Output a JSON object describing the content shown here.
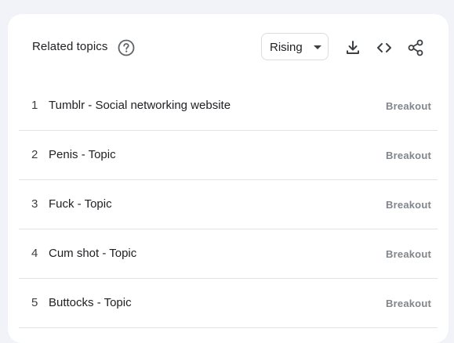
{
  "header": {
    "title": "Related topics",
    "help_icon": "help-circle-icon",
    "filter": {
      "selected": "Rising",
      "icon": "dropdown-caret-icon"
    },
    "tools": [
      "download-icon",
      "embed-code-icon",
      "share-icon"
    ]
  },
  "topics": [
    {
      "rank": "1",
      "label": "Tumblr - Social networking website",
      "value": "Breakout"
    },
    {
      "rank": "2",
      "label": "Penis - Topic",
      "value": "Breakout"
    },
    {
      "rank": "3",
      "label": "Fuck - Topic",
      "value": "Breakout"
    },
    {
      "rank": "4",
      "label": "Cum shot - Topic",
      "value": "Breakout"
    },
    {
      "rank": "5",
      "label": "Buttocks - Topic",
      "value": "Breakout"
    }
  ],
  "colors": {
    "page_bg": "#f1f3f8",
    "card_bg": "#ffffff",
    "text": "#202124",
    "muted": "#80868b",
    "divider": "#e3e3e3"
  }
}
